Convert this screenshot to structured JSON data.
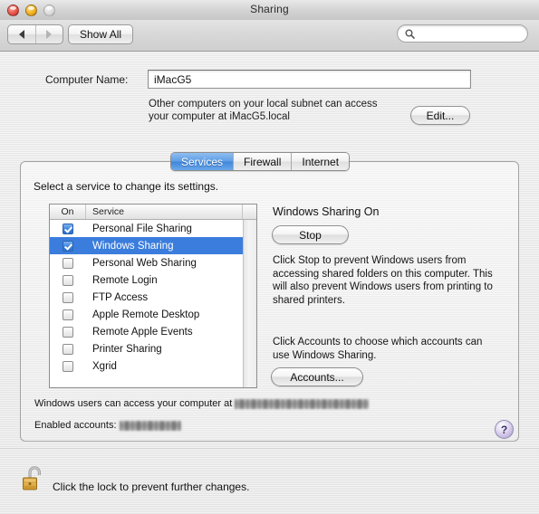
{
  "window": {
    "title": "Sharing",
    "traffic_lights": [
      "close",
      "minimize",
      "zoom"
    ]
  },
  "toolbar": {
    "back_label": "",
    "forward_label": "",
    "show_all_label": "Show All",
    "search_value": "",
    "search_placeholder": ""
  },
  "computer_name": {
    "label": "Computer Name:",
    "value": "iMacG5",
    "placeholder": "",
    "hint_line1": "Other computers on your local subnet can access",
    "hint_line2": "your computer at iMacG5.local",
    "edit_label": "Edit..."
  },
  "tabs": [
    {
      "label": "Services",
      "selected": true
    },
    {
      "label": "Firewall",
      "selected": false
    },
    {
      "label": "Internet",
      "selected": false
    }
  ],
  "services_pane": {
    "instruction": "Select a service to change its settings.",
    "columns": {
      "on": "On",
      "service": "Service"
    },
    "rows": [
      {
        "service": "Personal File Sharing",
        "on": true,
        "selected": false
      },
      {
        "service": "Windows Sharing",
        "on": true,
        "selected": true
      },
      {
        "service": "Personal Web Sharing",
        "on": false,
        "selected": false
      },
      {
        "service": "Remote Login",
        "on": false,
        "selected": false
      },
      {
        "service": "FTP Access",
        "on": false,
        "selected": false
      },
      {
        "service": "Apple Remote Desktop",
        "on": false,
        "selected": false
      },
      {
        "service": "Remote Apple Events",
        "on": false,
        "selected": false
      },
      {
        "service": "Printer Sharing",
        "on": false,
        "selected": false
      },
      {
        "service": "Xgrid",
        "on": false,
        "selected": false
      }
    ]
  },
  "detail": {
    "title": "Windows Sharing On",
    "stop_label": "Stop",
    "description": "Click Stop to prevent Windows users from accessing shared folders on this computer. This will also prevent Windows users from printing to shared printers.",
    "accounts_description": "Click Accounts to choose which accounts can use Windows Sharing.",
    "accounts_label": "Accounts..."
  },
  "status": {
    "access_label": "Windows users can access your computer at",
    "access_value_redacted": true,
    "enabled_accounts_label": "Enabled accounts:",
    "enabled_accounts_redacted": true,
    "help_label": "?"
  },
  "footer": {
    "lock_text": "Click the lock to prevent further changes.",
    "lock_state": "unlocked"
  },
  "colors": {
    "selection_blue": "#3b7ddd",
    "active_tab_blue": "#3f86dc",
    "help_purple": "#c2b3de",
    "lock_gold": "#d8a33b"
  }
}
